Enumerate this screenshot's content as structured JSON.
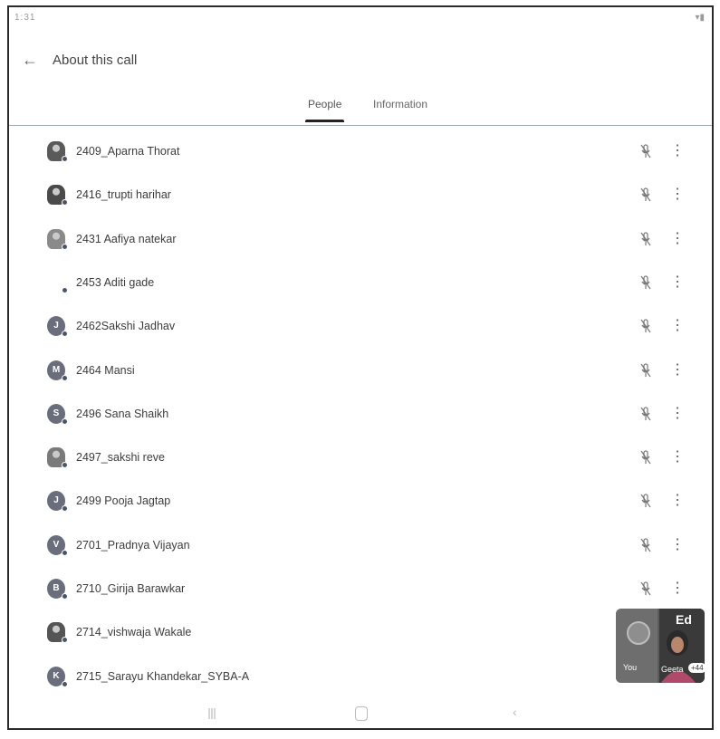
{
  "status_bar": {
    "time": "1:31",
    "right_text": ""
  },
  "app_bar": {
    "back_icon": "arrow-left-icon",
    "title": "About this call"
  },
  "tabs": [
    {
      "label": "People",
      "active": true
    },
    {
      "label": "Information",
      "active": false
    }
  ],
  "participants": [
    {
      "name": "2409_Aparna Thorat",
      "avatar": "photo",
      "initial": ""
    },
    {
      "name": "2416_trupti harihar",
      "avatar": "photo",
      "initial": ""
    },
    {
      "name": "2431 Aafiya natekar",
      "avatar": "photo",
      "initial": ""
    },
    {
      "name": "2453 Aditi gade",
      "avatar": "none",
      "initial": ""
    },
    {
      "name": "2462Sakshi Jadhav",
      "avatar": "letter",
      "initial": "J"
    },
    {
      "name": "2464 Mansi",
      "avatar": "letter",
      "initial": "M"
    },
    {
      "name": "2496 Sana Shaikh",
      "avatar": "letter",
      "initial": "S"
    },
    {
      "name": "2497_sakshi reve",
      "avatar": "photo",
      "initial": ""
    },
    {
      "name": "2499 Pooja Jagtap",
      "avatar": "letter",
      "initial": "J"
    },
    {
      "name": "2701_Pradnya Vijayan",
      "avatar": "letter",
      "initial": "V"
    },
    {
      "name": "2710_Girija Barawkar",
      "avatar": "letter",
      "initial": "B"
    },
    {
      "name": "2714_vishwaja Wakale",
      "avatar": "photo",
      "initial": ""
    },
    {
      "name": "2715_Sarayu Khandekar_SYBA-A",
      "avatar": "letter",
      "initial": "K"
    }
  ],
  "pip": {
    "self_label": "You",
    "other_label": "Geeta",
    "badge": "+44",
    "sign": "Ed"
  },
  "icons": {
    "mic_off": "mic-off-icon",
    "more": "more-vert-icon"
  }
}
